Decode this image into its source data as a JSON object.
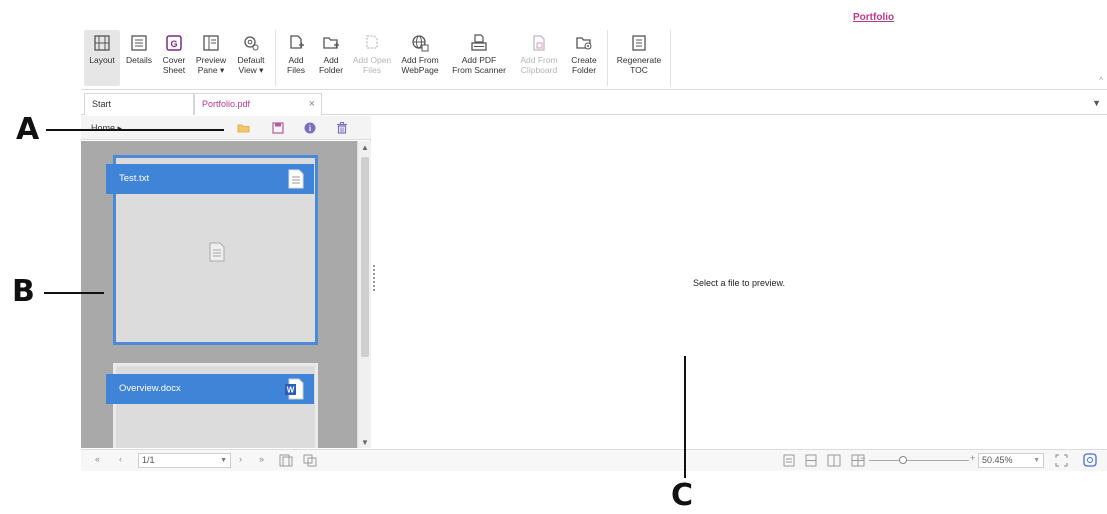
{
  "ribbon": {
    "tab_title": "Portfolio",
    "buttons": [
      {
        "id": "layout",
        "line1": "Layout",
        "line2": "",
        "icon": "layout-icon",
        "active": true,
        "disabled": false
      },
      {
        "id": "details",
        "line1": "Details",
        "line2": "",
        "icon": "details-icon",
        "active": false,
        "disabled": false
      },
      {
        "id": "cover",
        "line1": "Cover",
        "line2": "Sheet",
        "icon": "cover-sheet-icon",
        "active": false,
        "disabled": false
      },
      {
        "id": "preview",
        "line1": "Preview",
        "line2": "Pane ▾",
        "icon": "preview-pane-icon",
        "active": false,
        "disabled": false
      },
      {
        "id": "default-view",
        "line1": "Default",
        "line2": "View ▾",
        "icon": "default-view-icon",
        "active": false,
        "disabled": false
      },
      {
        "id": "add-files",
        "line1": "Add",
        "line2": "Files",
        "icon": "add-files-icon",
        "active": false,
        "disabled": false
      },
      {
        "id": "add-folder",
        "line1": "Add",
        "line2": "Folder",
        "icon": "add-folder-icon",
        "active": false,
        "disabled": false
      },
      {
        "id": "add-open-files",
        "line1": "Add Open",
        "line2": "Files",
        "icon": "add-open-files-icon",
        "active": false,
        "disabled": true
      },
      {
        "id": "add-from-webpage",
        "line1": "Add From",
        "line2": "WebPage",
        "icon": "globe-icon",
        "active": false,
        "disabled": false
      },
      {
        "id": "add-pdf-scanner",
        "line1": "Add PDF",
        "line2": "From Scanner",
        "icon": "scanner-icon",
        "active": false,
        "disabled": false
      },
      {
        "id": "add-from-clipboard",
        "line1": "Add From",
        "line2": "Clipboard",
        "icon": "clipboard-icon",
        "active": false,
        "disabled": true
      },
      {
        "id": "create-folder",
        "line1": "Create",
        "line2": "Folder",
        "icon": "create-folder-icon",
        "active": false,
        "disabled": false
      },
      {
        "id": "regenerate-toc",
        "line1": "Regenerate",
        "line2": "TOC",
        "icon": "toc-icon",
        "active": false,
        "disabled": false
      }
    ]
  },
  "tabs": [
    {
      "label": "Start"
    },
    {
      "label": "Portfolio.pdf",
      "close": "×"
    }
  ],
  "left_pane": {
    "breadcrumb": "Home ▸",
    "toolbar_icons": [
      "open-folder-icon",
      "save-icon",
      "info-icon",
      "delete-icon"
    ],
    "files": [
      {
        "name": "Test.txt",
        "icon": "text-file-icon",
        "selected": true
      },
      {
        "name": "Overview.docx",
        "icon": "word-file-icon",
        "selected": false
      }
    ]
  },
  "preview": {
    "message": "Select a file to preview."
  },
  "statusbar": {
    "page": "1/1",
    "zoom": "50.45%",
    "zoom_minus": "−",
    "zoom_plus": "+"
  },
  "callouts": {
    "a": "A",
    "b": "B",
    "c": "C"
  },
  "colors": {
    "accent": "#b73a8c",
    "file_header": "#3f84d6",
    "thumb_bg": "#a9a9a9"
  }
}
